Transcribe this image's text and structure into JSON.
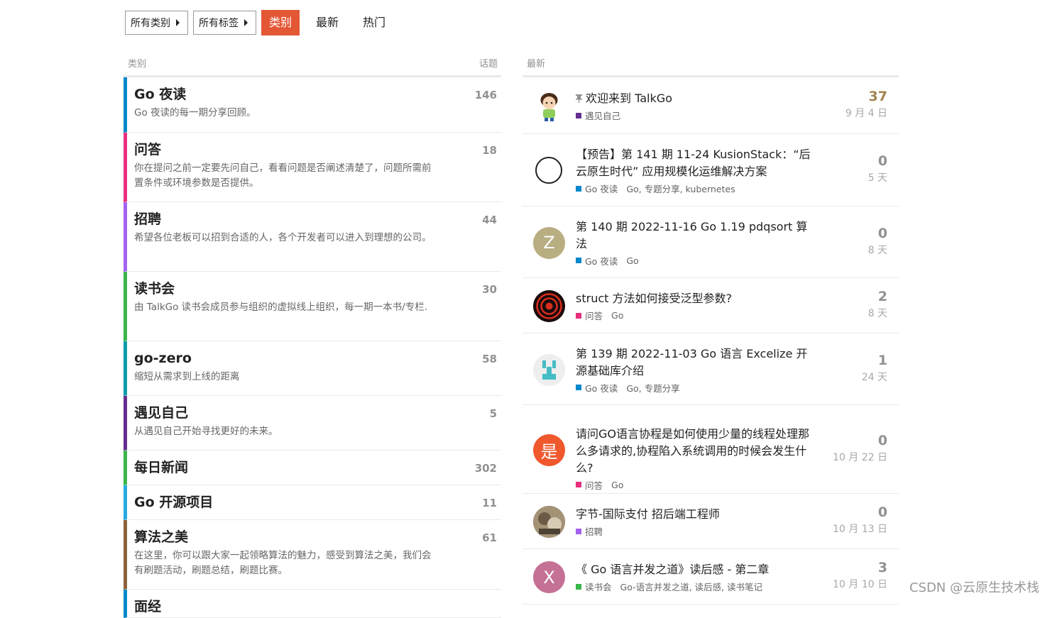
{
  "nav": {
    "all_categories": "所有类别",
    "all_tags": "所有标签",
    "tabs": [
      {
        "label": "类别",
        "active": true
      },
      {
        "label": "最新",
        "active": false
      },
      {
        "label": "热门",
        "active": false
      }
    ]
  },
  "categories_header": {
    "category": "类别",
    "topics": "话题"
  },
  "categories": [
    {
      "name": "Go 夜读",
      "desc": "Go 夜读的每一期分享回顾。",
      "count": "146",
      "color": "#0088cc"
    },
    {
      "name": "问答",
      "desc": "你在提问之前一定要先问自己，看看问题是否阐述清楚了，问题所需前置条件或环境参数是否提供。",
      "count": "18",
      "color": "#e92e7d"
    },
    {
      "name": "招聘",
      "desc": "希望各位老板可以招到合适的人，各个开发者可以进入到理想的公司。",
      "count": "44",
      "color": "#a461ef"
    },
    {
      "name": "读书会",
      "desc": "由 TalkGo 读书会成员参与组织的虚拟线上组织，每一期一本书/专栏.",
      "count": "30",
      "color": "#3ab54a"
    },
    {
      "name": "go-zero",
      "desc": "缩短从需求到上线的距离",
      "count": "58",
      "color": "#0e9ba9"
    },
    {
      "name": "遇见自己",
      "desc": "从遇见自己开始寻找更好的未来。",
      "count": "5",
      "color": "#652d90"
    },
    {
      "name": "每日新闻",
      "desc": "",
      "count": "302",
      "color": "#3ab54a"
    },
    {
      "name": "Go 开源项目",
      "desc": "",
      "count": "11",
      "color": "#25aae2"
    },
    {
      "name": "算法之美",
      "desc": "在这里，你可以跟大家一起领略算法的魅力，感受到算法之美，我们会有刷题活动，刷题总结，刷题比赛。",
      "count": "61",
      "color": "#8c6238"
    },
    {
      "name": "面经",
      "desc": "",
      "count": "",
      "color": "#0088cc"
    }
  ],
  "latest_header": {
    "label": "最新"
  },
  "topics": [
    {
      "title": "欢迎来到 TalkGo",
      "pinned": true,
      "category": "遇见自己",
      "cat_color": "#652d90",
      "tags": "",
      "posts": "37",
      "hot": true,
      "date": "9 月 4 日",
      "avatar": "cartoon",
      "avatar_color": "#ffffff",
      "avatar_letter": ""
    },
    {
      "title": "【预告】第 141 期 11-24 KusionStack：“后云原生时代” 应用规模化运维解决方案",
      "pinned": false,
      "category": "Go 夜读",
      "cat_color": "#0088cc",
      "tags": "Go, 专题分享, kubernetes",
      "posts": "0",
      "hot": false,
      "date": "5 天",
      "avatar": "circle-outline",
      "avatar_color": "#ffffff",
      "avatar_letter": ""
    },
    {
      "title": "第 140 期 2022-11-16 Go 1.19 pdqsort 算法",
      "pinned": false,
      "category": "Go 夜读",
      "cat_color": "#0088cc",
      "tags": "Go",
      "posts": "0",
      "hot": false,
      "date": "8 天",
      "avatar": "letter",
      "avatar_color": "#b9ae82",
      "avatar_letter": "Z"
    },
    {
      "title": "struct 方法如何接受泛型参数?",
      "pinned": false,
      "category": "问答",
      "cat_color": "#e92e7d",
      "tags": "Go",
      "posts": "2",
      "hot": false,
      "date": "8 天",
      "avatar": "spiral",
      "avatar_color": "#1a0b0b",
      "avatar_letter": ""
    },
    {
      "title": "第 139 期 2022-11-03 Go 语言 Excelize 开源基础库介绍",
      "pinned": false,
      "category": "Go 夜读",
      "cat_color": "#0088cc",
      "tags": "Go, 专题分享",
      "posts": "1",
      "hot": false,
      "date": "24 天",
      "avatar": "identicon",
      "avatar_color": "#eeeeee",
      "avatar_letter": ""
    },
    {
      "title": "请问GO语言协程是如何使用少量的线程处理那么多请求的,协程陷入系统调用的时候会发生什么?",
      "pinned": false,
      "category": "问答",
      "cat_color": "#e92e7d",
      "tags": "Go",
      "posts": "0",
      "hot": false,
      "date": "10 月 22 日",
      "avatar": "letter",
      "avatar_color": "#f0582e",
      "avatar_letter": "是"
    },
    {
      "title": "字节-国际支付 招后端工程师",
      "pinned": false,
      "category": "招聘",
      "cat_color": "#a461ef",
      "tags": "",
      "posts": "0",
      "hot": false,
      "date": "10 月 13 日",
      "avatar": "photo",
      "avatar_color": "#8a7a63",
      "avatar_letter": ""
    },
    {
      "title": "《 Go 语言并发之道》读后感 - 第二章",
      "pinned": false,
      "category": "读书会",
      "cat_color": "#3ab54a",
      "tags": "Go-语言并发之道, 读后感, 读书笔记",
      "posts": "3",
      "hot": false,
      "date": "10 月 10 日",
      "avatar": "letter",
      "avatar_color": "#c57196",
      "avatar_letter": "X"
    }
  ],
  "watermark": "CSDN @云原生技术栈"
}
